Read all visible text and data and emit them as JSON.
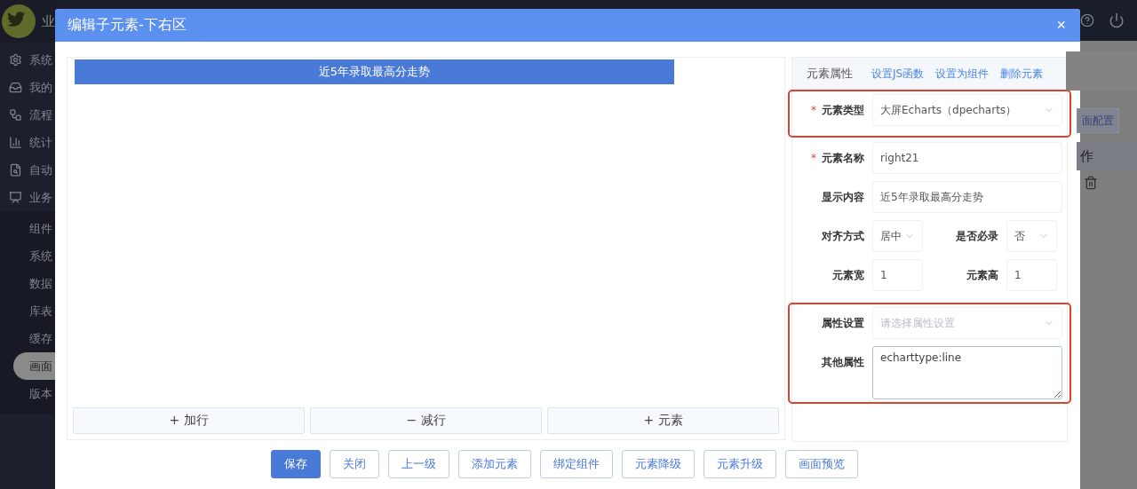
{
  "topbar": {
    "title": "业"
  },
  "sidebar": {
    "items": [
      {
        "label": "系统",
        "selected": false
      },
      {
        "label": "我的",
        "selected": false
      },
      {
        "label": "流程",
        "selected": false
      },
      {
        "label": "统计",
        "selected": false
      },
      {
        "label": "自动",
        "selected": false
      },
      {
        "label": "业务",
        "selected": false,
        "children": [
          {
            "label": "组件",
            "selected": false
          },
          {
            "label": "系统",
            "selected": false
          },
          {
            "label": "数据",
            "selected": false
          },
          {
            "label": "库表",
            "selected": false
          },
          {
            "label": "缓存",
            "selected": false
          },
          {
            "label": "画面",
            "selected": true
          },
          {
            "label": "版本",
            "selected": false
          }
        ]
      }
    ]
  },
  "dialog": {
    "title": "编辑子元素-下右区",
    "close": "×",
    "canvas": {
      "element": "近5年录取最高分走势",
      "buttons": [
        "+ 加行",
        "− 减行",
        "+ 元素"
      ]
    },
    "properties": {
      "title": "元素属性",
      "links": [
        "设置JS函数",
        "设置为组件",
        "删除元素"
      ],
      "groups": [
        {
          "highlighted": true,
          "rows": [
            [
              {
                "kind": "select",
                "mark": "*",
                "label": "元素类型",
                "value": "大屏Echarts（dpecharts）"
              }
            ]
          ]
        },
        {
          "rows": [
            [
              {
                "kind": "input",
                "mark": "*",
                "label": "元素名称",
                "value": "right21"
              }
            ],
            [
              {
                "kind": "input",
                "label": "显示内容",
                "value": "近5年录取最高分走势"
              }
            ],
            [
              {
                "kind": "select",
                "label": "对齐方式",
                "value": "居中"
              },
              {
                "kind": "select",
                "label": "是否必录",
                "value": "否"
              }
            ],
            [
              {
                "kind": "input",
                "label": "元素宽",
                "value": "1"
              },
              {
                "kind": "input",
                "label": "元素高",
                "value": "1"
              }
            ]
          ]
        },
        {
          "highlighted": true,
          "rows": [
            [
              {
                "kind": "select",
                "label": "属性设置",
                "placeholder": "请选择属性设置"
              }
            ],
            [
              {
                "kind": "textarea",
                "label": "其他属性",
                "value": "echarttype:line"
              }
            ]
          ]
        }
      ]
    },
    "footer": [
      {
        "label": "保存",
        "primary": true
      },
      {
        "label": "关闭",
        "primary": false
      },
      {
        "label": "上一级",
        "primary": false
      },
      {
        "label": "添加元素",
        "primary": false
      },
      {
        "label": "绑定组件",
        "primary": false
      },
      {
        "label": "元素降级",
        "primary": false
      },
      {
        "label": "元素升级",
        "primary": false
      },
      {
        "label": "画面预览",
        "primary": false
      }
    ]
  },
  "background": {
    "button": "面配置",
    "column_header": "作"
  }
}
